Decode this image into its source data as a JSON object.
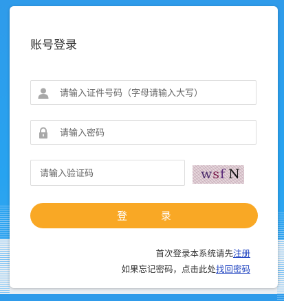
{
  "login": {
    "title": "账号登录",
    "id_placeholder": "请输入证件号码（字母请输入大写）",
    "password_placeholder": "请输入密码",
    "captcha_placeholder": "请输入验证码",
    "captcha_text": [
      "w",
      "s",
      "f",
      "N"
    ],
    "login_button": "登 录",
    "register_prefix": "首次登录本系统请先",
    "register_link": "注册",
    "recover_prefix": "如果忘记密码，点击此处",
    "recover_link": "找回密码"
  },
  "colors": {
    "background": "#2f9bea",
    "button": "#f9a825",
    "link": "#1a3fbf"
  },
  "icons": {
    "id_field": "user-icon",
    "password_field": "lock-icon"
  }
}
